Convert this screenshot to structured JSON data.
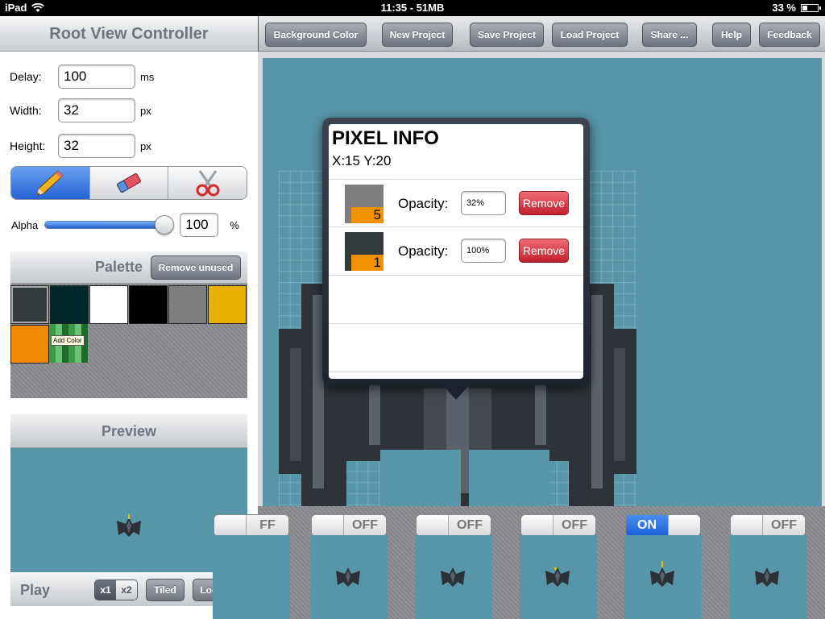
{
  "status": {
    "device": "iPad",
    "center": "11:35 - 51MB",
    "battery": "33 %"
  },
  "sidebar": {
    "title": "Root View Controller",
    "delay": {
      "label": "Delay:",
      "value": "100",
      "unit": "ms"
    },
    "width": {
      "label": "Width:",
      "value": "32",
      "unit": "px"
    },
    "height": {
      "label": "Height:",
      "value": "32",
      "unit": "px"
    },
    "tools": [
      "pencil-icon",
      "eraser-icon",
      "scissors-icon"
    ],
    "alpha": {
      "label": "Alpha",
      "value": "100",
      "unit": "%",
      "level": 1.0
    },
    "palette": {
      "title": "Palette",
      "remove_unused": "Remove unused",
      "add_color": "Add Color",
      "colors": [
        "#333a3c",
        "#00262e",
        "#ffffff",
        "#000000",
        "#7e7e7e",
        "#e8b000",
        "#f08a00"
      ]
    },
    "preview": {
      "title": "Preview"
    },
    "play": {
      "label": "Play",
      "x1": "x1",
      "x2": "x2",
      "tiled": "Tiled",
      "looped": "Looped"
    }
  },
  "toolbar": {
    "background_color": "Background Color",
    "new_project": "New Project",
    "save_project": "Save Project",
    "load_project": "Load Project",
    "share": "Share ...",
    "help": "Help",
    "feedback": "Feedback"
  },
  "pixel_info": {
    "title": "PIXEL INFO",
    "coords": "X:15 Y:20",
    "opacity_label": "Opacity:",
    "remove_label": "Remove",
    "layers": [
      {
        "index": "5",
        "color": "#7e7e7e",
        "opacity": "32%"
      },
      {
        "index": "1",
        "color": "#333a3c",
        "opacity": "100%"
      }
    ]
  },
  "frames": [
    {
      "state": "FF"
    },
    {
      "state": "OFF"
    },
    {
      "state": "OFF"
    },
    {
      "state": "OFF"
    },
    {
      "state": "ON"
    },
    {
      "state": "OFF"
    }
  ],
  "colors": {
    "canvas_bg": "#5696a8",
    "accent": "#2463d6",
    "remove_red": "#c2202e",
    "badge_orange": "#f29100"
  }
}
